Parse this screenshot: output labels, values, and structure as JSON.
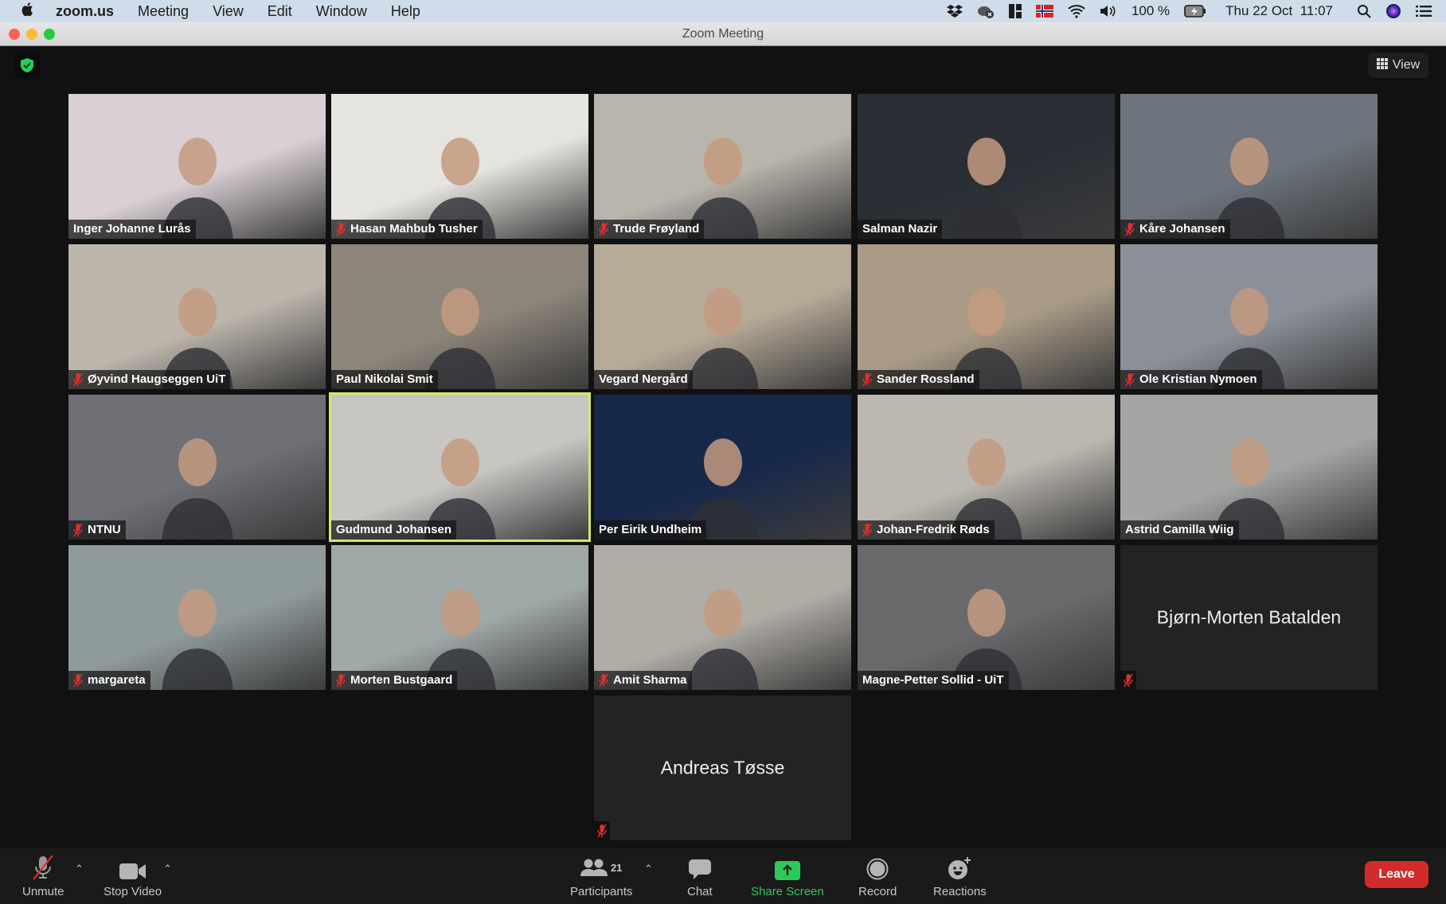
{
  "menubar": {
    "app_name": "zoom.us",
    "items": [
      "Meeting",
      "View",
      "Edit",
      "Window",
      "Help"
    ],
    "battery": "100 %",
    "datetime": "Thu 22 Oct  11:07",
    "status_icons": [
      "dropbox-icon",
      "cloud-disconnected-icon",
      "layout-icon",
      "norway-flag-icon",
      "wifi-icon",
      "volume-icon",
      "battery-charging-icon",
      "spotlight-search-icon",
      "siri-icon",
      "control-center-icon"
    ]
  },
  "window": {
    "title": "Zoom Meeting"
  },
  "meeting": {
    "view_label": "View",
    "participants": [
      {
        "name": "Inger Johanne Lurås",
        "muted": false,
        "video": true,
        "bg": "#d9cfd4"
      },
      {
        "name": "Hasan Mahbub Tusher",
        "muted": true,
        "video": true,
        "bg": "#e6e4df"
      },
      {
        "name": "Trude Frøyland",
        "muted": true,
        "video": true,
        "bg": "#b9b4ac"
      },
      {
        "name": "Salman Nazir",
        "muted": false,
        "video": true,
        "bg": "#2a2e35"
      },
      {
        "name": "Kåre Johansen",
        "muted": true,
        "video": true,
        "bg": "#6d747d"
      },
      {
        "name": "Øyvind Haugseggen UiT",
        "muted": true,
        "video": true,
        "bg": "#bdb6ac"
      },
      {
        "name": "Paul Nikolai Smit",
        "muted": false,
        "video": true,
        "bg": "#8d857a"
      },
      {
        "name": "Vegard Nergård",
        "muted": false,
        "video": true,
        "bg": "#b7aa98"
      },
      {
        "name": "Sander Rossland",
        "muted": true,
        "video": true,
        "bg": "#a99b87"
      },
      {
        "name": "Ole Kristian Nymoen",
        "muted": true,
        "video": true,
        "bg": "#8a8f98"
      },
      {
        "name": "NTNU",
        "muted": true,
        "video": true,
        "bg": "#6e7076"
      },
      {
        "name": "Gudmund Johansen",
        "muted": false,
        "video": true,
        "bg": "#c7c6c3",
        "active_speaker": true
      },
      {
        "name": "Per Eirik Undheim",
        "muted": false,
        "video": true,
        "bg": "#17284a"
      },
      {
        "name": "Johan-Fredrik Røds",
        "muted": true,
        "video": true,
        "bg": "#bcb8b1"
      },
      {
        "name": "Astrid Camilla Wiig",
        "muted": false,
        "video": true,
        "bg": "#a3a6a2"
      },
      {
        "name": "margareta",
        "muted": true,
        "video": true,
        "bg": "#8f9a9b"
      },
      {
        "name": "Morten Bustgaard",
        "muted": true,
        "video": true,
        "bg": "#9fa9a8"
      },
      {
        "name": "Amit Sharma",
        "muted": true,
        "video": true,
        "bg": "#b0aca6"
      },
      {
        "name": "Magne-Petter Sollid - UiT",
        "muted": false,
        "video": true,
        "bg": "#6a6a6c"
      },
      {
        "name": "Bjørn-Morten Batalden",
        "muted": true,
        "video": false
      },
      {
        "name": "Andreas Tøsse",
        "muted": true,
        "video": false
      }
    ]
  },
  "toolbar": {
    "unmute": "Unmute",
    "stop_video": "Stop Video",
    "participants": "Participants",
    "participants_count": "21",
    "chat": "Chat",
    "share_screen": "Share Screen",
    "record": "Record",
    "reactions": "Reactions",
    "leave": "Leave"
  },
  "colors": {
    "active_speaker_border": "#d4e86a",
    "share_green": "#2ec95a",
    "leave_red": "#d12b2b",
    "muted_red": "#e0302e"
  }
}
